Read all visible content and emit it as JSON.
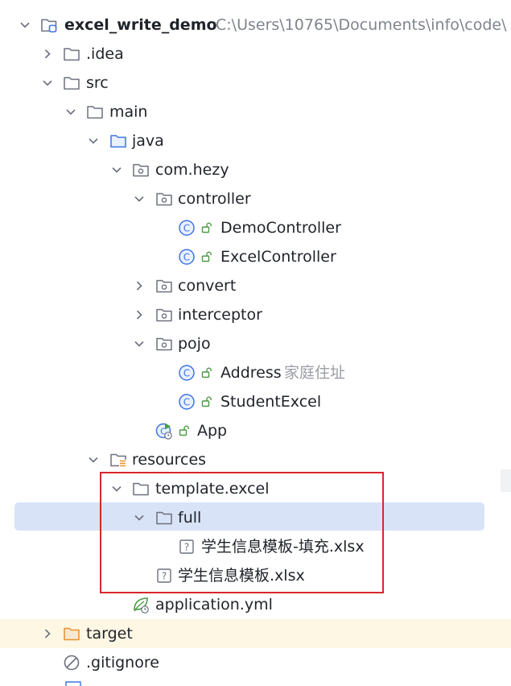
{
  "project": {
    "name": "excel_write_demo",
    "path": "C:\\Users\\10765\\Documents\\info\\code\\"
  },
  "tree": {
    "idea": ".idea",
    "src": "src",
    "main": "main",
    "java": "java",
    "pkg": "com.hezy",
    "controller": "controller",
    "demo_controller": "DemoController",
    "excel_controller": "ExcelController",
    "convert": "convert",
    "interceptor": "interceptor",
    "pojo": "pojo",
    "address": "Address",
    "address_hint": "家庭住址",
    "student_excel": "StudentExcel",
    "app": "App",
    "resources": "resources",
    "template_excel": "template.excel",
    "full": "full",
    "template_fill_file": "学生信息模板-填充.xlsx",
    "template_file": "学生信息模板.xlsx",
    "application_yml": "application.yml",
    "target": "target",
    "gitignore": ".gitignore"
  },
  "colors": {
    "selection": "#d8e3f7",
    "excluded_folder_row": "#fdf7e3",
    "annotation_box": "#d9262e",
    "class_icon": "#3d74e8",
    "source_folder": "#3d74e8",
    "excluded_folder": "#e8912c",
    "access_icon": "#4a9a43"
  },
  "icons": {
    "chevron_open": "chevron-down-icon",
    "chevron_closed": "chevron-right-icon",
    "folder": "folder-icon",
    "package": "package-icon",
    "class": "class-icon",
    "unknown_file": "unknown-file-icon"
  }
}
